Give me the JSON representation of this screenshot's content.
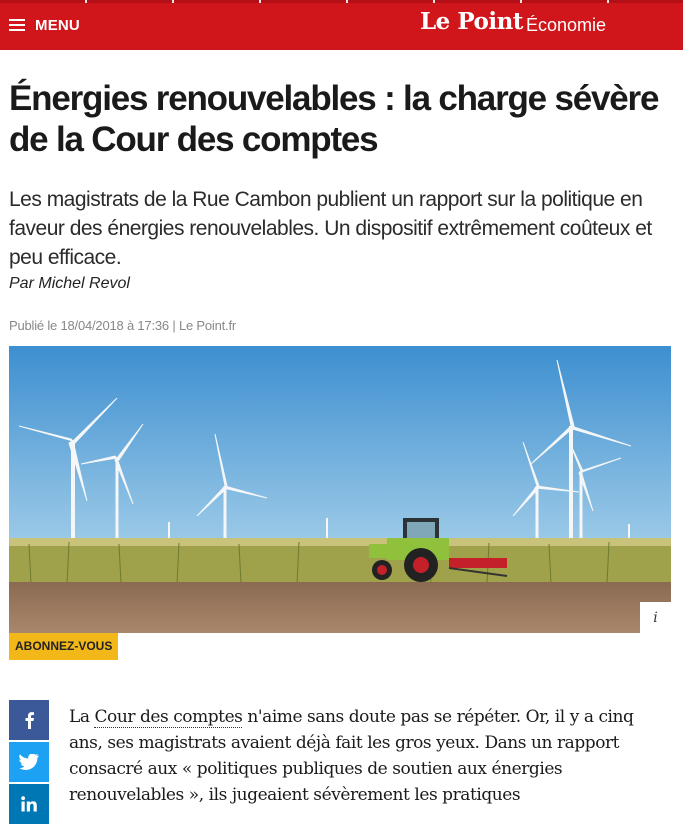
{
  "header": {
    "menu_label": "MENU",
    "brand": "Le Point",
    "section": "Économie",
    "bar_color": "#d1161b"
  },
  "article": {
    "title": "Énergies renouvelables : la charge sévère de la Cour des comptes",
    "chapo": "Les magistrats de la Rue Cambon publient un rapport sur la politique en faveur des énergies renouvelables. Un dispositif extrêmement coûteux et peu efficace.",
    "byline_prefix": "Par",
    "author": "Michel Revol",
    "published_prefix": "Publié le 18/04/2018 à 17:36 |",
    "published_source": "Le Point.fr"
  },
  "image": {
    "description_icon": "wind-farm-tractor-photo",
    "info_label": "i",
    "subscribe_label": "ABONNEZ-VOUS",
    "subscribe_color": "#f2b81a"
  },
  "social": [
    {
      "icon": "facebook-icon",
      "color": "#3b5998"
    },
    {
      "icon": "twitter-icon",
      "color": "#1da1f2"
    },
    {
      "icon": "linkedin-icon",
      "color": "#0077b5"
    }
  ],
  "body": {
    "lead": "La ",
    "link_text": "Cour des comptes",
    "rest": " n'aime sans doute pas se répéter. Or, il y a cinq ans, ses magistrats avaient déjà fait les gros yeux. Dans un rapport consacré aux « politiques publiques de soutien aux énergies renouvelables », ils jugeaient sévèrement les pratiques"
  }
}
